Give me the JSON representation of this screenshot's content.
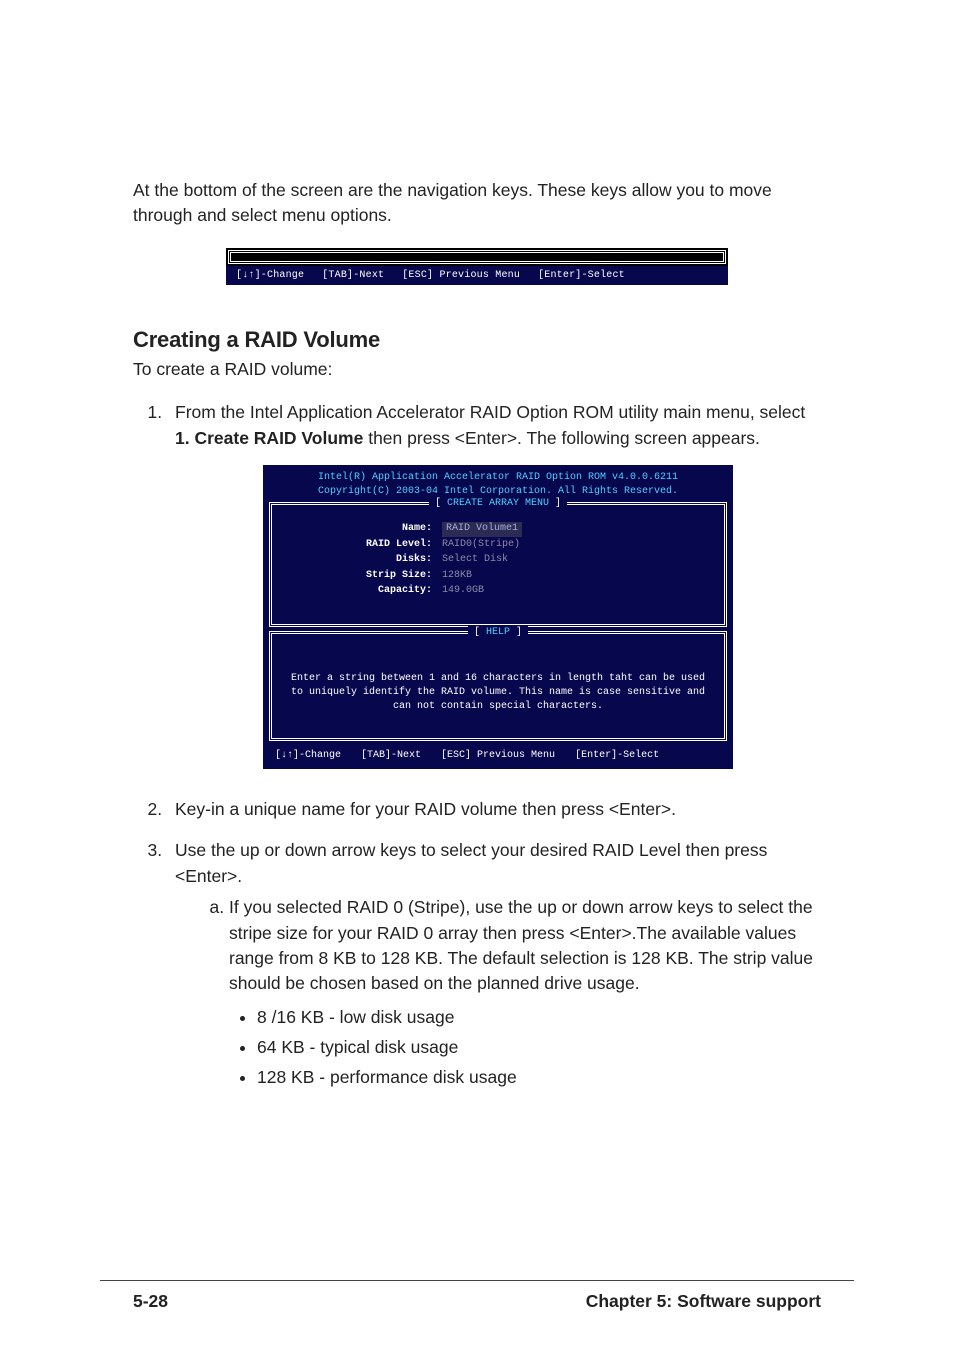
{
  "intro": "At the bottom of the screen are the navigation keys. These keys allow you to move through and select menu options.",
  "nav": {
    "change": "[↓↑]-Change",
    "next": "[TAB]-Next",
    "prev": "[ESC] Previous Menu",
    "select": "[Enter]-Select"
  },
  "heading": "Creating a RAID Volume",
  "subtitle": "To create a RAID volume:",
  "step1": {
    "pre": "From the Intel Application Accelerator RAID Option ROM utility main menu, select ",
    "bold": "1. Create RAID Volume",
    "post": " then press <Enter>. The following screen appears."
  },
  "bios": {
    "title1": "Intel(R) Application Accelerator RAID Option ROM v4.0.0.6211",
    "title2": "Copyright(C) 2003-04 Intel Corporation. All Rights Reserved.",
    "createLabel": "CREATE ARRAY MENU",
    "fields": {
      "name_k": "Name:",
      "name_v": "RAID Volume1",
      "level_k": "RAID Level:",
      "level_v": "RAID0(Stripe)",
      "disks_k": "Disks:",
      "disks_v": "Select Disk",
      "strip_k": "Strip Size:",
      "strip_v": "128KB",
      "cap_k": "Capacity:",
      "cap_v": "149.0GB"
    },
    "helpLabel": "HELP",
    "helpText1": "Enter a string between 1 and 16 characters in length taht can be used",
    "helpText2": "to uniquely identify the RAID volume. This name is case sensitive and",
    "helpText3": "can not contain special characters."
  },
  "step2": "Key-in a unique name for your RAID volume then press <Enter>.",
  "step3": "Use the up or down arrow keys to select your desired RAID Level then press <Enter>.",
  "step3a": "If you selected RAID 0 (Stripe), use the up or down arrow keys to select the stripe size for your RAID 0 array then press <Enter>.The available values range from 8 KB to 128 KB. The default selection is 128 KB. The strip value should be chosen based on the planned drive usage.",
  "bullets": {
    "b1": "8 /16 KB - low disk usage",
    "b2": "64 KB - typical disk usage",
    "b3": "128 KB - performance disk usage"
  },
  "footer": {
    "left": "5-28",
    "right": "Chapter 5: Software support"
  }
}
